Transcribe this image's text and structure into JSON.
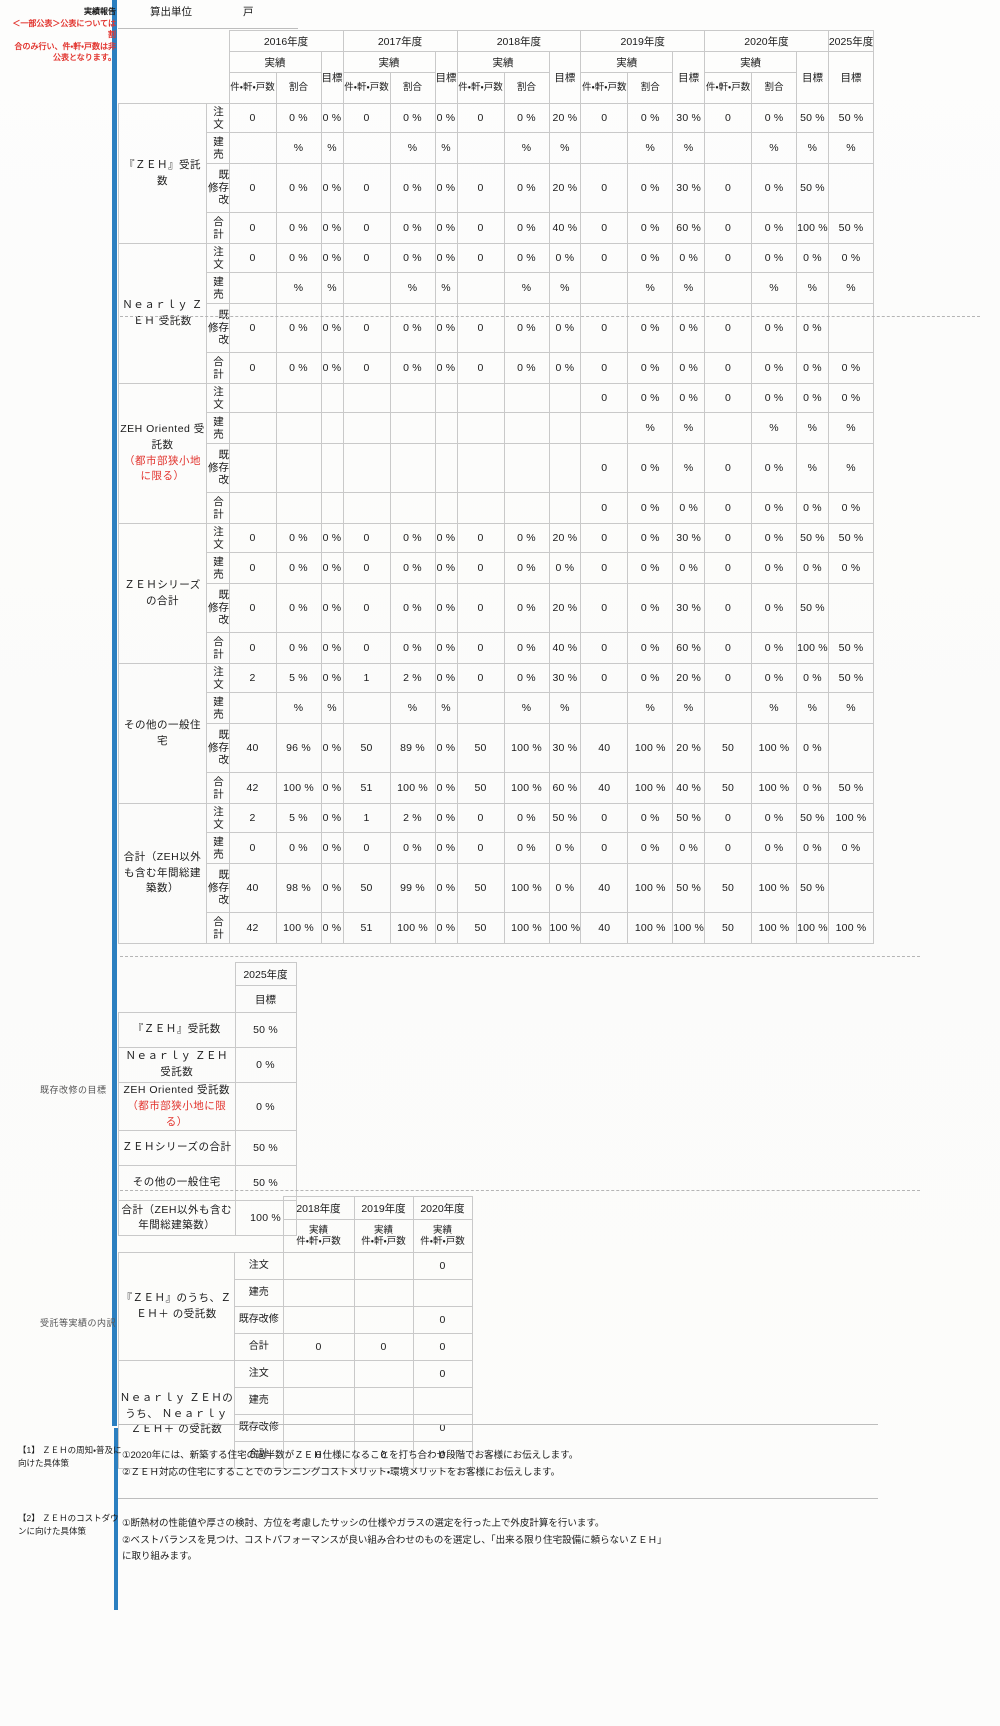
{
  "top": {
    "note_line1": "実績報告",
    "note_line2": "＜一部公表＞公表については割",
    "note_line3": "合のみ行い、件・軒・戸数は非",
    "note_line4": "公表となります。",
    "unit_label": "算出単位",
    "unit_value": "戸"
  },
  "main_table": {
    "years": [
      "2016年度",
      "2017年度",
      "2018年度",
      "2019年度",
      "2020年度",
      "2025年度"
    ],
    "actual_label": "実績",
    "col_count_label": "件・軒・戸数",
    "col_ratio_label": "割合",
    "col_target_label": "目標",
    "sub_rows": [
      "注文",
      "建売",
      "既存改修",
      "合計"
    ],
    "groups": [
      {
        "name": "『ＺＥＨ』受託数",
        "note": "",
        "rows": [
          {
            "label": "注文",
            "cells": [
              "0",
              "0 %",
              "0 %",
              "0",
              "0 %",
              "0 %",
              "0",
              "0 %",
              "20 %",
              "0",
              "0 %",
              "30 %",
              "0",
              "0 %",
              "50 %",
              "50 %"
            ]
          },
          {
            "label": "建売",
            "cells": [
              "",
              "%",
              "%",
              "",
              "%",
              "%",
              "",
              "%",
              "%",
              "",
              "%",
              "%",
              "",
              "%",
              "%",
              "%"
            ]
          },
          {
            "label": "既存改修",
            "cells": [
              "0",
              "0 %",
              "0 %",
              "0",
              "0 %",
              "0 %",
              "0",
              "0 %",
              "20 %",
              "0",
              "0 %",
              "30 %",
              "0",
              "0 %",
              "50 %",
              ""
            ]
          },
          {
            "label": "合計",
            "cells": [
              "0",
              "0 %",
              "0 %",
              "0",
              "0 %",
              "0 %",
              "0",
              "0 %",
              "40 %",
              "0",
              "0 %",
              "60 %",
              "0",
              "0 %",
              "100 %",
              "50 %"
            ]
          }
        ]
      },
      {
        "name": "Ｎｅａｒｌｙ ＺＥＨ 受託数",
        "note": "",
        "rows": [
          {
            "label": "注文",
            "cells": [
              "0",
              "0 %",
              "0 %",
              "0",
              "0 %",
              "0 %",
              "0",
              "0 %",
              "0 %",
              "0",
              "0 %",
              "0 %",
              "0",
              "0 %",
              "0 %",
              "0 %"
            ]
          },
          {
            "label": "建売",
            "cells": [
              "",
              "%",
              "%",
              "",
              "%",
              "%",
              "",
              "%",
              "%",
              "",
              "%",
              "%",
              "",
              "%",
              "%",
              "%"
            ]
          },
          {
            "label": "既存改修",
            "cells": [
              "0",
              "0 %",
              "0 %",
              "0",
              "0 %",
              "0 %",
              "0",
              "0 %",
              "0 %",
              "0",
              "0 %",
              "0 %",
              "0",
              "0 %",
              "0 %",
              ""
            ]
          },
          {
            "label": "合計",
            "cells": [
              "0",
              "0 %",
              "0 %",
              "0",
              "0 %",
              "0 %",
              "0",
              "0 %",
              "0 %",
              "0",
              "0 %",
              "0 %",
              "0",
              "0 %",
              "0 %",
              "0 %"
            ]
          }
        ]
      },
      {
        "name": "ZEH Oriented 受託数",
        "note": "（都市部狭小地に限る）",
        "rows": [
          {
            "label": "注文",
            "cells": [
              "",
              "",
              "",
              "",
              "",
              "",
              "",
              "",
              "",
              "0",
              "0 %",
              "0 %",
              "0",
              "0 %",
              "0 %",
              "0 %"
            ]
          },
          {
            "label": "建売",
            "cells": [
              "",
              "",
              "",
              "",
              "",
              "",
              "",
              "",
              "",
              "",
              "%",
              "%",
              "",
              "%",
              "%",
              "%"
            ]
          },
          {
            "label": "既存改修",
            "cells": [
              "",
              "",
              "",
              "",
              "",
              "",
              "",
              "",
              "",
              "0",
              "0 %",
              "%",
              "0",
              "0 %",
              "%",
              "%"
            ]
          },
          {
            "label": "合計",
            "cells": [
              "",
              "",
              "",
              "",
              "",
              "",
              "",
              "",
              "",
              "0",
              "0 %",
              "0 %",
              "0",
              "0 %",
              "0 %",
              "0 %"
            ]
          }
        ]
      },
      {
        "name": "ＺＥＨシリーズの合計",
        "note": "",
        "rows": [
          {
            "label": "注文",
            "cells": [
              "0",
              "0 %",
              "0 %",
              "0",
              "0 %",
              "0 %",
              "0",
              "0 %",
              "20 %",
              "0",
              "0 %",
              "30 %",
              "0",
              "0 %",
              "50 %",
              "50 %"
            ]
          },
          {
            "label": "建売",
            "cells": [
              "0",
              "0 %",
              "0 %",
              "0",
              "0 %",
              "0 %",
              "0",
              "0 %",
              "0 %",
              "0",
              "0 %",
              "0 %",
              "0",
              "0 %",
              "0 %",
              "0 %"
            ]
          },
          {
            "label": "既存改修",
            "cells": [
              "0",
              "0 %",
              "0 %",
              "0",
              "0 %",
              "0 %",
              "0",
              "0 %",
              "20 %",
              "0",
              "0 %",
              "30 %",
              "0",
              "0 %",
              "50 %",
              ""
            ]
          },
          {
            "label": "合計",
            "cells": [
              "0",
              "0 %",
              "0 %",
              "0",
              "0 %",
              "0 %",
              "0",
              "0 %",
              "40 %",
              "0",
              "0 %",
              "60 %",
              "0",
              "0 %",
              "100 %",
              "50 %"
            ]
          }
        ]
      },
      {
        "name": "その他の一般住宅",
        "note": "",
        "rows": [
          {
            "label": "注文",
            "cells": [
              "2",
              "5 %",
              "0 %",
              "1",
              "2 %",
              "0 %",
              "0",
              "0 %",
              "30 %",
              "0",
              "0 %",
              "20 %",
              "0",
              "0 %",
              "0 %",
              "50 %"
            ]
          },
          {
            "label": "建売",
            "cells": [
              "",
              "%",
              "%",
              "",
              "%",
              "%",
              "",
              "%",
              "%",
              "",
              "%",
              "%",
              "",
              "%",
              "%",
              "%"
            ]
          },
          {
            "label": "既存改修",
            "cells": [
              "40",
              "96 %",
              "0 %",
              "50",
              "89 %",
              "0 %",
              "50",
              "100 %",
              "30 %",
              "40",
              "100 %",
              "20 %",
              "50",
              "100 %",
              "0 %",
              ""
            ]
          },
          {
            "label": "合計",
            "cells": [
              "42",
              "100 %",
              "0 %",
              "51",
              "100 %",
              "0 %",
              "50",
              "100 %",
              "60 %",
              "40",
              "100 %",
              "40 %",
              "50",
              "100 %",
              "0 %",
              "50 %"
            ]
          }
        ]
      },
      {
        "name": "合計（ZEH以外も含む年間総建築数）",
        "note": "",
        "rows": [
          {
            "label": "注文",
            "cells": [
              "2",
              "5 %",
              "0 %",
              "1",
              "2 %",
              "0 %",
              "0",
              "0 %",
              "50 %",
              "0",
              "0 %",
              "50 %",
              "0",
              "0 %",
              "50 %",
              "100 %"
            ]
          },
          {
            "label": "建売",
            "cells": [
              "0",
              "0 %",
              "0 %",
              "0",
              "0 %",
              "0 %",
              "0",
              "0 %",
              "0 %",
              "0",
              "0 %",
              "0 %",
              "0",
              "0 %",
              "0 %",
              "0 %"
            ]
          },
          {
            "label": "既存改修",
            "cells": [
              "40",
              "98 %",
              "0 %",
              "50",
              "99 %",
              "0 %",
              "50",
              "100 %",
              "0 %",
              "40",
              "100 %",
              "50 %",
              "50",
              "100 %",
              "50 %",
              ""
            ]
          },
          {
            "label": "合計",
            "cells": [
              "42",
              "100 %",
              "0 %",
              "51",
              "100 %",
              "0 %",
              "50",
              "100 %",
              "100 %",
              "40",
              "100 %",
              "100 %",
              "50",
              "100 %",
              "100 %",
              "100 %"
            ]
          }
        ]
      }
    ]
  },
  "reno_table": {
    "section_label": "既存改修の目標",
    "year": "2025年度",
    "target_label": "目標",
    "rows": [
      {
        "label": "『ＺＥＨ』受託数",
        "note": "",
        "value": "50 %"
      },
      {
        "label": "Ｎｅａｒｌｙ ＺＥＨ 受託数",
        "note": "",
        "value": "0 %"
      },
      {
        "label": "ZEH Oriented 受託数",
        "note": "（都市部狭小地に限る）",
        "value": "0 %"
      },
      {
        "label": "ＺＥＨシリーズの合計",
        "note": "",
        "value": "50 %"
      },
      {
        "label": "その他の一般住宅",
        "note": "",
        "value": "50 %"
      },
      {
        "label": "合計（ZEH以外も含む年間総建築数）",
        "note": "",
        "value": "100 %"
      }
    ]
  },
  "zehplus_table": {
    "section_label": "受託等実績の内訳",
    "years": [
      "2018年度",
      "2019年度",
      "2020年度"
    ],
    "actual_label": "実績",
    "count_label": "件・軒・戸数",
    "groups": [
      {
        "name": "『ＺＥＨ』のうち、ＺＥＨ＋ の受託数",
        "rows": [
          {
            "label": "注文",
            "cells": [
              "",
              "",
              "0"
            ]
          },
          {
            "label": "建売",
            "cells": [
              "",
              "",
              ""
            ]
          },
          {
            "label": "既存改修",
            "cells": [
              "",
              "",
              "0"
            ]
          },
          {
            "label": "合計",
            "cells": [
              "0",
              "0",
              "0"
            ]
          }
        ]
      },
      {
        "name": "Ｎｅａｒｌｙ ＺＥＨのうち、 Ｎｅａｒｌｙ ＺＥＨ＋ の受託数",
        "rows": [
          {
            "label": "注文",
            "cells": [
              "",
              "",
              "0"
            ]
          },
          {
            "label": "建売",
            "cells": [
              "",
              "",
              ""
            ]
          },
          {
            "label": "既存改修",
            "cells": [
              "",
              "",
              "0"
            ]
          },
          {
            "label": "合計",
            "cells": [
              "0",
              "0",
              "0"
            ]
          }
        ]
      }
    ]
  },
  "footnotes": [
    {
      "index": "【1】",
      "title": "ＺＥＨの周知・普及に向けた具体策",
      "lines": [
        "①2020年には、新築する住宅の過半数がＺＥＨ仕様になることを打ち合わせ段階でお客様にお伝えします。",
        "②ＺＥＨ対応の住宅にすることでのランニングコストメリット・環境メリットをお客様にお伝えします。"
      ]
    },
    {
      "index": "【2】",
      "title": "ＺＥＨのコストダウンに向けた具体策",
      "lines": [
        "①断熱材の性能値や厚さの検討、方位を考慮したサッシの仕様やガラスの選定を行った上で外皮計算を行います。",
        "②ベストバランスを見つけ、コストパフォーマンスが良い組み合わせのものを選定し、「出来る限り住宅設備に頼らないＺＥＨ」",
        "に取り組みます。"
      ]
    }
  ]
}
